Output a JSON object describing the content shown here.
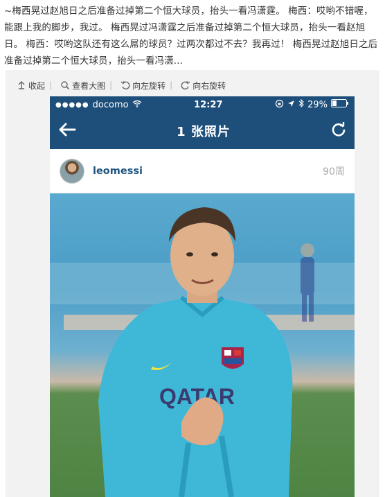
{
  "post": {
    "text": "~梅西晃过赵旭日之后准备过掉第二个恒大球员，抬头一看冯潇霆。 梅西：哎哟不错喔，能跟上我的脚步，我过。 梅西晃过冯潇霆之后准备过掉第二个恒大球员，抬头一看赵旭日。 梅西：哎哟这队还有这么屌的球员？过两次都过不去？我再过！ 梅西晃过赵旭日之后准备过掉第二个恒大球员，抬头一看冯潇..."
  },
  "toolbar": {
    "collapse": "收起",
    "view_large": "查看大图",
    "rotate_left": "向左旋转",
    "rotate_right": "向右旋转"
  },
  "status_bar": {
    "carrier": "docomo",
    "time": "12:27",
    "battery": "29%"
  },
  "nav": {
    "title": "1 张照片"
  },
  "post_header": {
    "username": "leomessi",
    "age": "90周"
  },
  "photo": {
    "sponsor_text": "QATAR"
  },
  "colors": {
    "nav_bg": "#1e4f7a",
    "username": "#1e5580",
    "jersey": "#3fb8d8"
  }
}
